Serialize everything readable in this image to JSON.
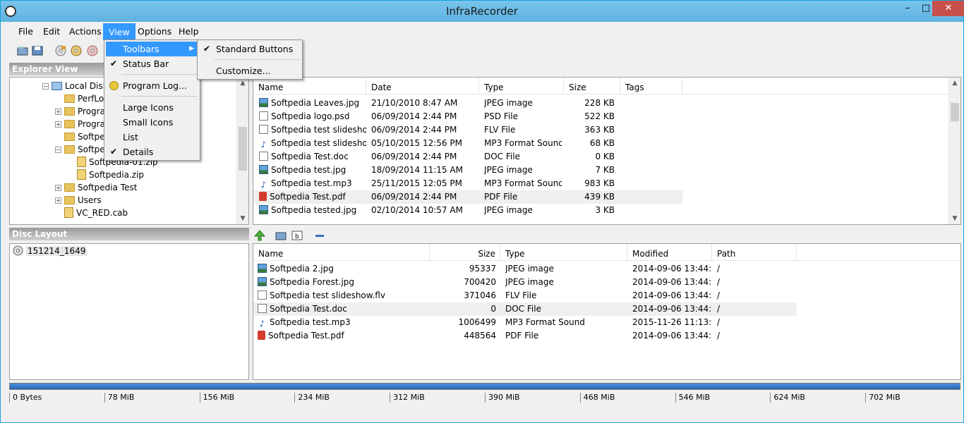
{
  "window": {
    "title": "InfraRecorder",
    "controls": {
      "minimize": "–",
      "maximize": "□",
      "close": "✕"
    }
  },
  "menubar": {
    "items": [
      "File",
      "Edit",
      "Actions",
      "View",
      "Options",
      "Help"
    ]
  },
  "view_menu": {
    "items": [
      {
        "label": "Toolbars",
        "checked": false,
        "has_submenu": true,
        "selected": true
      },
      {
        "label": "Status Bar",
        "checked": true
      },
      {
        "label": "Program Log...",
        "checked": false,
        "icon": "log-icon"
      },
      {
        "label": "Large Icons",
        "checked": false
      },
      {
        "label": "Small Icons",
        "checked": false
      },
      {
        "label": "List",
        "checked": false
      },
      {
        "label": "Details",
        "checked": true
      }
    ]
  },
  "toolbars_submenu": {
    "items": [
      {
        "label": "Standard Buttons",
        "checked": true
      },
      {
        "label": "Customize...",
        "checked": false
      }
    ]
  },
  "explorer": {
    "title": "Explorer View",
    "tree": [
      {
        "label": "Local Disk",
        "indent": 2,
        "type": "drive",
        "expander": "−"
      },
      {
        "label": "PerfLo",
        "indent": 3,
        "type": "folder",
        "expander": ""
      },
      {
        "label": "Progra",
        "indent": 3,
        "type": "folder",
        "expander": "+"
      },
      {
        "label": "Progra",
        "indent": 3,
        "type": "folder",
        "expander": "+"
      },
      {
        "label": "Softpe",
        "indent": 3,
        "type": "folder",
        "expander": ""
      },
      {
        "label": "Softpe",
        "indent": 3,
        "type": "folder",
        "expander": "−"
      },
      {
        "label": "Softpedia-01.zip",
        "indent": 4,
        "type": "zip",
        "expander": ""
      },
      {
        "label": "Softpedia.zip",
        "indent": 4,
        "type": "zip",
        "expander": ""
      },
      {
        "label": "Softpedia Test",
        "indent": 3,
        "type": "folder",
        "expander": "+"
      },
      {
        "label": "Users",
        "indent": 3,
        "type": "folder",
        "expander": "+"
      },
      {
        "label": "VC_RED.cab",
        "indent": 3,
        "type": "zip",
        "expander": ""
      }
    ]
  },
  "files": {
    "columns": [
      "Name",
      "Date",
      "Type",
      "Size",
      "Tags"
    ],
    "rows": [
      {
        "name": "Softpedia Leaves.jpg",
        "date": "21/10/2010 8:47 AM",
        "type": "JPEG image",
        "size": "228 KB",
        "icon": "img"
      },
      {
        "name": "Softpedia logo.psd",
        "date": "06/09/2014 2:44 PM",
        "type": "PSD File",
        "size": "522 KB",
        "icon": "psd"
      },
      {
        "name": "Softpedia test slidesho...",
        "date": "06/09/2014 2:44 PM",
        "type": "FLV File",
        "size": "363 KB",
        "icon": "doc"
      },
      {
        "name": "Softpedia test slidesho...",
        "date": "05/10/2015 12:56 PM",
        "type": "MP3 Format Sound",
        "size": "68 KB",
        "icon": "audio"
      },
      {
        "name": "Softpedia Test.doc",
        "date": "06/09/2014 2:44 PM",
        "type": "DOC File",
        "size": "0 KB",
        "icon": "doc"
      },
      {
        "name": "Softpedia test.jpg",
        "date": "18/09/2014 11:15 AM",
        "type": "JPEG image",
        "size": "7 KB",
        "icon": "img"
      },
      {
        "name": "Softpedia test.mp3",
        "date": "25/11/2015 12:05 PM",
        "type": "MP3 Format Sound",
        "size": "983 KB",
        "icon": "audio"
      },
      {
        "name": "Softpedia Test.pdf",
        "date": "06/09/2014 2:44 PM",
        "type": "PDF File",
        "size": "439 KB",
        "icon": "pdf",
        "highlight": true
      },
      {
        "name": "Softpedia tested.jpg",
        "date": "02/10/2014 10:57 AM",
        "type": "JPEG image",
        "size": "3 KB",
        "icon": "img"
      }
    ]
  },
  "disc_layout": {
    "title": "Disc Layout",
    "root": "151214_1649"
  },
  "disc_files": {
    "columns": [
      "Name",
      "Size",
      "Type",
      "Modified",
      "Path"
    ],
    "rows": [
      {
        "name": "Softpedia 2.jpg",
        "size": "95337",
        "type": "JPEG image",
        "modified": "2014-09-06 13:44:20",
        "path": "/",
        "icon": "img"
      },
      {
        "name": "Softpedia Forest.jpg",
        "size": "700420",
        "type": "JPEG image",
        "modified": "2014-09-06 13:44:18",
        "path": "/",
        "icon": "img"
      },
      {
        "name": "Softpedia test slideshow.flv",
        "size": "371046",
        "type": "FLV File",
        "modified": "2014-09-06 13:44:18",
        "path": "/",
        "icon": "doc"
      },
      {
        "name": "Softpedia Test.doc",
        "size": "0",
        "type": "DOC File",
        "modified": "2014-09-06 13:44:20",
        "path": "/",
        "icon": "doc",
        "highlight": true
      },
      {
        "name": "Softpedia test.mp3",
        "size": "1006499",
        "type": "MP3 Format Sound",
        "modified": "2015-11-26 11:13:42",
        "path": "/",
        "icon": "audio"
      },
      {
        "name": "Softpedia Test.pdf",
        "size": "448564",
        "type": "PDF File",
        "modified": "2014-09-06 13:44:20",
        "path": "/",
        "icon": "pdf"
      }
    ]
  },
  "capacity": {
    "fill_fraction": 1.0,
    "ticks": [
      "0 Bytes",
      "78 MiB",
      "156 MiB",
      "234 MiB",
      "312 MiB",
      "390 MiB",
      "468 MiB",
      "546 MiB",
      "624 MiB",
      "702 MiB"
    ]
  },
  "colors": {
    "menu_highlight": "#3399ff",
    "titlebar": "#6bbce4",
    "close_button": "#c7504b",
    "progress_fill": "#2a65b8"
  }
}
